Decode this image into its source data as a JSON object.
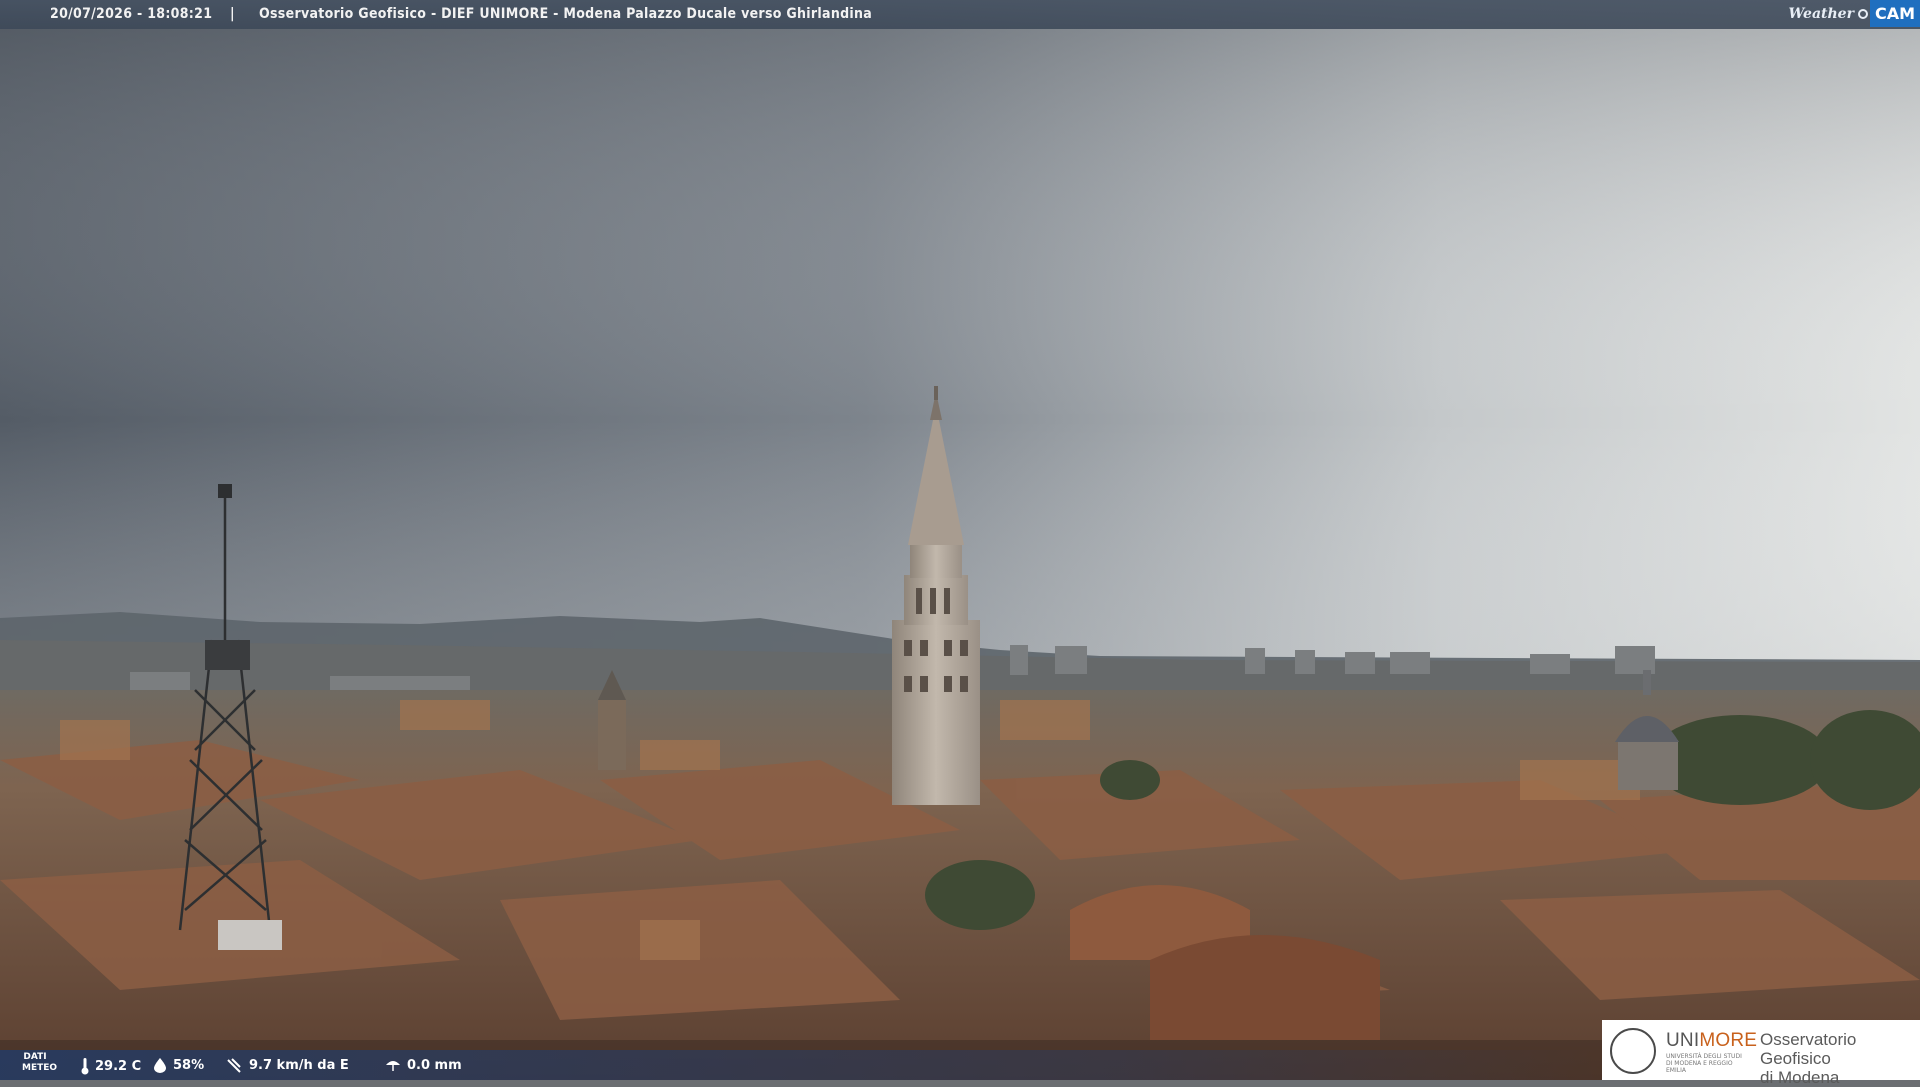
{
  "header": {
    "datetime": "20/07/2026 - 18:08:21",
    "separator": "|",
    "title": "Osservatorio Geofisico - DIEF UNIMORE - Modena Palazzo Ducale verso Ghirlandina",
    "brand_weather": "Weather",
    "brand_cam": "CAM"
  },
  "weather": {
    "label_line1": "DATI",
    "label_line2": "METEO",
    "temperature": "29.2 C",
    "humidity": "58%",
    "wind": "9.7 km/h da E",
    "rain": "0.0 mm"
  },
  "logo": {
    "uni_a": "UNI",
    "uni_b": "MORE",
    "uni_small": "UNIVERSITÀ DEGLI STUDI DI MODENA E REGGIO EMILIA",
    "obs_line1": "Osservatorio Geofisico",
    "obs_line2": "di Modena"
  },
  "colors": {
    "sky_dark": "#5f6670",
    "sky_light": "#d9dcdd",
    "roof": "#8a5a40",
    "tower": "#b9ada0",
    "brand_cam_bg": "#1f6fbf",
    "uni_accent": "#c8611c"
  },
  "icons": [
    "thermometer-icon",
    "humidity-drop-icon",
    "wind-icon",
    "rain-gauge-icon",
    "unimore-seal-icon"
  ]
}
